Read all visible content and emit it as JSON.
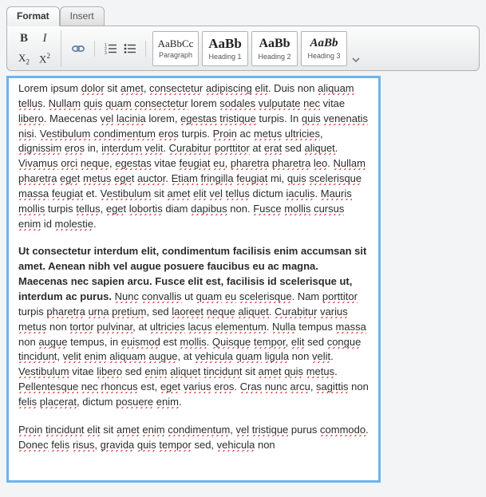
{
  "tabs": {
    "format": "Format",
    "insert": "Insert"
  },
  "styles": {
    "para": {
      "preview": "AaBbCc",
      "caption": "Paragraph"
    },
    "h1": {
      "preview": "AaBb",
      "caption": "Heading 1"
    },
    "h2": {
      "preview": "AaBb",
      "caption": "Heading 2"
    },
    "h3": {
      "preview": "AaBb",
      "caption": "Heading 3"
    }
  },
  "glyphs": {
    "bold": "B",
    "italic": "I",
    "sub": "X",
    "sub2": "2",
    "sup": "X",
    "sup2": "2"
  },
  "doc": {
    "p1": {
      "t0": "Lorem ipsum ",
      "s0": "dolor",
      "t1": " sit ",
      "s1": "amet",
      "t2": ", ",
      "s2": "consectetur",
      "t3": " ",
      "s3": "adipiscing",
      "t4": " ",
      "s4": "elit",
      "t5": ". Duis non ",
      "s5": "aliquam",
      "t6": " ",
      "s6": "tellus",
      "t7": ". ",
      "s7": "Nullam",
      "t8": " ",
      "s8": "quis",
      "t9": " ",
      "s9": "quam",
      "t10": " ",
      "s10": "consectetur",
      "t11": " lorem ",
      "s11": "sodales",
      "t12": " ",
      "s12": "vulputate",
      "t13": " ",
      "s13": "nec",
      "t14": " vitae ",
      "s14": "libero",
      "t15": ". Maecenas ",
      "s15": "vel",
      "t16": " ",
      "s16": "lacinia",
      "t17": " lorem, ",
      "s17": "egestas",
      "t18": " ",
      "s18": "tristique",
      "t19": " turpis. In ",
      "s19": "quis",
      "t20": " ",
      "s20": "venenatis",
      "t21": " ",
      "s21": "nisi",
      "t22": ". ",
      "s22": "Vestibulum",
      "t23": " ",
      "s23": "condimentum",
      "t24": " ",
      "s24": "eros",
      "t25": " turpis. ",
      "s25": "Proin",
      "t26": " ac ",
      "s26": "metus",
      "t27": " ",
      "s27": "ultricies",
      "t28": ", ",
      "s28": "dignissim",
      "t29": " ",
      "s29": "eros",
      "t30": " in, ",
      "s30": "interdum",
      "t31": " ",
      "s31": "velit",
      "t32": ". ",
      "s32": "Curabitur",
      "t33": " ",
      "s33": "porttitor",
      "t34": " at ",
      "s34": "erat",
      "t35": " sed ",
      "s35": "aliquet",
      "t36": ". ",
      "s36": "Vivamus",
      "t37": " ",
      "s37": "orci",
      "t38": " ",
      "s38": "neque",
      "t39": ", ",
      "s39": "egestas",
      "t40": " vitae ",
      "s40": "feugiat",
      "t41": " ",
      "s41": "eu",
      "t42": ", ",
      "s42": "pharetra",
      "t43": " ",
      "s43": "pharetra",
      "t44": " ",
      "s44": "leo",
      "t45": ". ",
      "s45": "Nullam",
      "t46": " ",
      "s46": "pharetra",
      "t47": " ",
      "s47": "eget",
      "t48": " ",
      "s48": "metus",
      "t49": " ",
      "s49": "eget",
      "t50": " ",
      "s50": "auctor",
      "t51": ". ",
      "s51": "Etiam",
      "t52": " ",
      "s52": "fringilla",
      "t53": " ",
      "s53": "feugiat",
      "t54": " mi, ",
      "s54": "quis",
      "t55": " ",
      "s55": "scelerisque",
      "t56": " ",
      "s56": "massa",
      "t57": " ",
      "s57": "feugiat",
      "t58": " et. ",
      "s58": "Vestibulum",
      "t59": " sit ",
      "s59": "amet",
      "t60": " ",
      "s60": "elit",
      "t61": " ",
      "s61": "vel",
      "t62": " ",
      "s62": "tellus",
      "t63": " dictum ",
      "s63": "iaculis",
      "t64": ". ",
      "s64": "Mauris",
      "t65": " ",
      "s65": "mollis",
      "t66": " turpis ",
      "s66": "tellus",
      "t67": ", ",
      "s67": "eget",
      "t68": " ",
      "s68": "lobortis",
      "t69": " diam ",
      "s69": "dapibus",
      "t70": " non. ",
      "s70": "Fusce",
      "t71": " ",
      "s71": "mollis",
      "t72": " ",
      "s72": "cursus",
      "t73": " ",
      "s73": "enim",
      "t74": " id ",
      "s74": "molestie",
      "t75": "."
    },
    "p2": {
      "b0": "Ut consectetur interdum elit, condimentum facilisis enim accumsan sit amet. Aenean nibh vel augue posuere faucibus eu ac magna. Maecenas nec sapien arcu. Fusce elit est, facilisis id scelerisque ut, interdum ac purus.",
      "t0": " ",
      "s0": "Nunc",
      "t1": " ",
      "s1": "convallis",
      "t2": " ut ",
      "s2": "quam",
      "t3": " ",
      "s3": "eu",
      "t4": " ",
      "s4": "scelerisque",
      "t5": ". Nam ",
      "s5": "porttitor",
      "t6": " turpis ",
      "s6": "pharetra",
      "t7": " ",
      "s7": "urna",
      "t8": " ",
      "s8": "pretium",
      "t9": ", sed ",
      "s9": "laoreet",
      "t10": " ",
      "s10": "neque",
      "t11": " ",
      "s11": "aliquet",
      "t12": ". ",
      "s12": "Curabitur",
      "t13": " ",
      "s13": "varius",
      "t14": " ",
      "s14": "metus",
      "t15": " non ",
      "s15": "tortor",
      "t16": " ",
      "s16": "pulvinar",
      "t17": ", at ",
      "s17": "ultricies",
      "t18": " ",
      "s18": "lacus",
      "t19": " ",
      "s19": "elementum",
      "t20": ". ",
      "s20": "Nulla",
      "t21": " tempus ",
      "s21": "massa",
      "t22": " non ",
      "s22": "augue",
      "t23": " tempus, in ",
      "s23": "euismod",
      "t24": " est ",
      "s24": "mollis",
      "t25": ". ",
      "s25": "Quisque",
      "t26": " ",
      "s26": "tempor",
      "t27": ", ",
      "s27": "elit",
      "t28": " sed ",
      "s28": "congue",
      "t29": " ",
      "s29": "tincidunt",
      "t30": ", ",
      "s30": "velit",
      "t31": " ",
      "s31": "enim",
      "t32": " ",
      "s32": "aliquam",
      "t33": " ",
      "s33": "augue",
      "t34": ", at ",
      "s34": "vehicula",
      "t35": " ",
      "s35": "quam",
      "t36": " ",
      "s36": "ligula",
      "t37": " non ",
      "s37": "velit",
      "t38": ". ",
      "s38": "Vestibulum",
      "t39": " vitae ",
      "s39": "libero",
      "t40": " sed ",
      "s40": "enim",
      "t41": " ",
      "s41": "aliquet",
      "t42": " ",
      "s42": "tincidunt",
      "t43": " sit ",
      "s43": "amet",
      "t44": " ",
      "s44": "quis",
      "t45": " ",
      "s45": "metus",
      "t46": ". ",
      "s46": "Pellentesque",
      "t47": " ",
      "s47": "nec",
      "t48": " ",
      "s48": "rhoncus",
      "t49": " est, ",
      "s49": "eget",
      "t50": " ",
      "s50": "varius",
      "t51": " ",
      "s51": "eros",
      "t52": ". ",
      "s52": "Cras",
      "t53": " ",
      "s53": "nunc",
      "t54": " ",
      "s54": "arcu",
      "t55": ", ",
      "s55": "sagittis",
      "t56": " non ",
      "s56": "felis",
      "t57": " ",
      "s57": "placerat",
      "t58": ", dictum ",
      "s58": "posuere",
      "t59": " ",
      "s59": "enim",
      "t60": "."
    },
    "p3": {
      "s0": "Proin",
      "t0": " ",
      "s1": "tincidunt",
      "t1": " ",
      "s2": "elit",
      "t2": " sit ",
      "s3": "amet",
      "t3": " ",
      "s4": "enim",
      "t4": " ",
      "s5": "condimentum",
      "t5": ", ",
      "s6": "vel",
      "t6": " ",
      "s7": "tristique",
      "t7": " purus ",
      "s8": "commodo",
      "t8": ". ",
      "s9": "Donec",
      "t9": " ",
      "s10": "felis",
      "t10": " ",
      "s11": "risus",
      "t11": ", ",
      "s12": "gravida",
      "t12": " ",
      "s13": "quis",
      "t13": " ",
      "s14": "tempor",
      "t14": " sed, ",
      "s15": "vehicula",
      "t15": " non"
    }
  }
}
